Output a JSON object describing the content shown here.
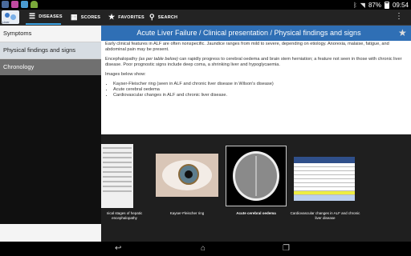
{
  "status_bar": {
    "battery": "87%",
    "time": "09:54",
    "icons": [
      "app-notification-icon",
      "app-notification-icon",
      "app-notification-icon",
      "android-icon",
      "bluetooth-icon",
      "wifi-icon",
      "battery-icon"
    ]
  },
  "action_bar": {
    "logo_text": "Liver",
    "tabs": [
      {
        "label": "DISEASES",
        "icon": "list-icon"
      },
      {
        "label": "SCORES",
        "icon": "calculator-icon"
      },
      {
        "label": "FAVORITES",
        "icon": "star-icon"
      },
      {
        "label": "SEARCH",
        "icon": "search-icon"
      }
    ]
  },
  "sidebar": {
    "items": [
      {
        "label": "Symptoms"
      },
      {
        "label": "Physical findings and signs"
      },
      {
        "label": "Chronology"
      }
    ]
  },
  "content": {
    "title": "Acute Liver Failure / Clinical presentation / Physical findings and signs",
    "para1": "Early clinical features in ALF are often nonspecific. Jaundice ranges from mild to severe, depending on etiology. Anorexia, malaise, fatigue, and abdominal pain may be present.",
    "para2_a": "Encephalopathy ",
    "para2_em": "(as per table below)",
    "para2_b": " can rapidly progress to cerebral oedema and brain stem herniation; a feature not seen in those with chronic liver disease. Poor prognostic signs include deep coma, a shrinking liver and hypoglycaemia.",
    "images_intro": "Images below show:",
    "bullets": [
      "Kayser-Fleischer ring (seen in ALF and chronic liver disease in Wilson's disease)",
      "Acute cerebral oedema",
      "Cardiovascular changes in ALF and chronic liver disease."
    ]
  },
  "gallery": {
    "captions": [
      "nical stages of hepatic encephalopathy",
      "Kayser-Fleischer ring",
      "Acute cerebral oedema",
      "Cardiovascular changes in ALF and chronic liver disease"
    ]
  },
  "colors": {
    "title_bar": "#2f6fb5",
    "tab_underline": "#3aa0e0"
  }
}
